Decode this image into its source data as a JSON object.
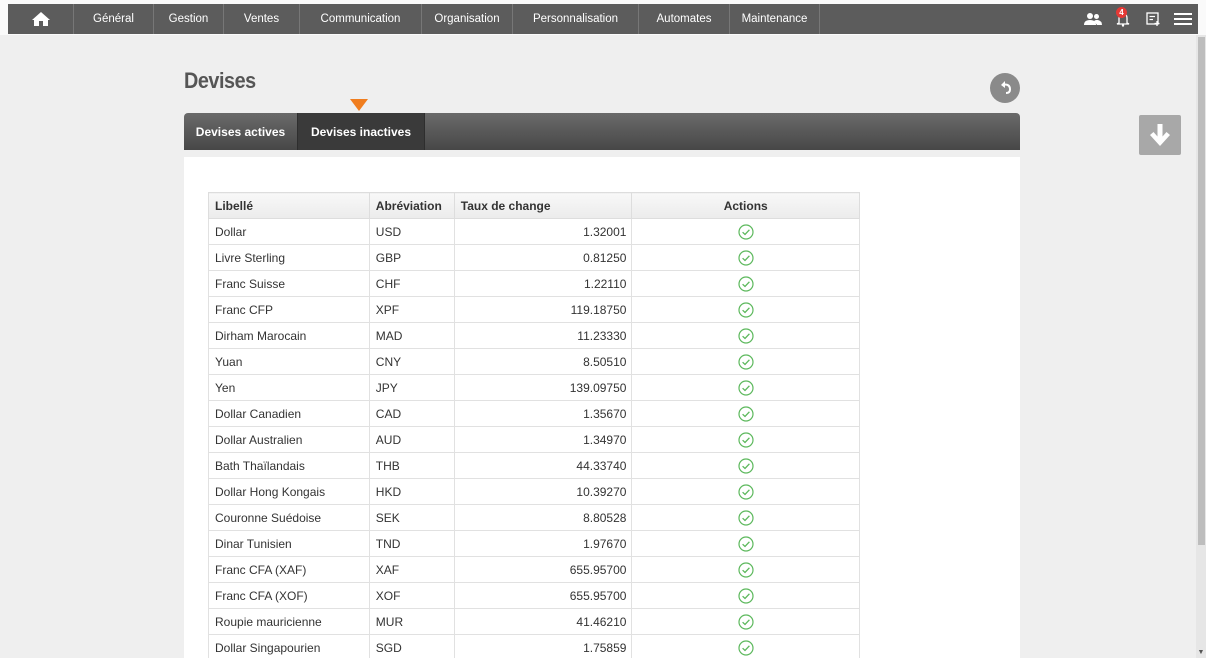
{
  "nav": {
    "items": [
      {
        "label": "Général",
        "width": 80
      },
      {
        "label": "Gestion",
        "width": 70
      },
      {
        "label": "Ventes",
        "width": 76
      },
      {
        "label": "Communication",
        "width": 122
      },
      {
        "label": "Organisation",
        "width": 91
      },
      {
        "label": "Personnalisation",
        "width": 126
      },
      {
        "label": "Automates",
        "width": 91
      },
      {
        "label": "Maintenance",
        "width": 90
      }
    ],
    "notification_count": "4"
  },
  "page": {
    "title": "Devises"
  },
  "tabs": {
    "active": "Devises actives",
    "inactive": "Devises inactives"
  },
  "table": {
    "headers": {
      "label": "Libellé",
      "abbr": "Abréviation",
      "rate": "Taux de change",
      "actions": "Actions"
    },
    "rows": [
      {
        "label": "Dollar",
        "abbr": "USD",
        "rate": "1.32001"
      },
      {
        "label": "Livre Sterling",
        "abbr": "GBP",
        "rate": "0.81250"
      },
      {
        "label": "Franc Suisse",
        "abbr": "CHF",
        "rate": "1.22110"
      },
      {
        "label": "Franc CFP",
        "abbr": "XPF",
        "rate": "119.18750"
      },
      {
        "label": "Dirham Marocain",
        "abbr": "MAD",
        "rate": "11.23330"
      },
      {
        "label": "Yuan",
        "abbr": "CNY",
        "rate": "8.50510"
      },
      {
        "label": "Yen",
        "abbr": "JPY",
        "rate": "139.09750"
      },
      {
        "label": "Dollar Canadien",
        "abbr": "CAD",
        "rate": "1.35670"
      },
      {
        "label": "Dollar Australien",
        "abbr": "AUD",
        "rate": "1.34970"
      },
      {
        "label": "Bath Thaïlandais",
        "abbr": "THB",
        "rate": "44.33740"
      },
      {
        "label": "Dollar Hong Kongais",
        "abbr": "HKD",
        "rate": "10.39270"
      },
      {
        "label": "Couronne Suédoise",
        "abbr": "SEK",
        "rate": "8.80528"
      },
      {
        "label": "Dinar Tunisien",
        "abbr": "TND",
        "rate": "1.97670"
      },
      {
        "label": "Franc CFA (XAF)",
        "abbr": "XAF",
        "rate": "655.95700"
      },
      {
        "label": "Franc CFA (XOF)",
        "abbr": "XOF",
        "rate": "655.95700"
      },
      {
        "label": "Roupie mauricienne",
        "abbr": "MUR",
        "rate": "41.46210"
      },
      {
        "label": "Dollar Singapourien",
        "abbr": "SGD",
        "rate": "1.75859"
      }
    ]
  },
  "colors": {
    "nav_bg": "#5c5c5c",
    "accent": "#f07d1e",
    "check_green": "#5cb85c"
  }
}
